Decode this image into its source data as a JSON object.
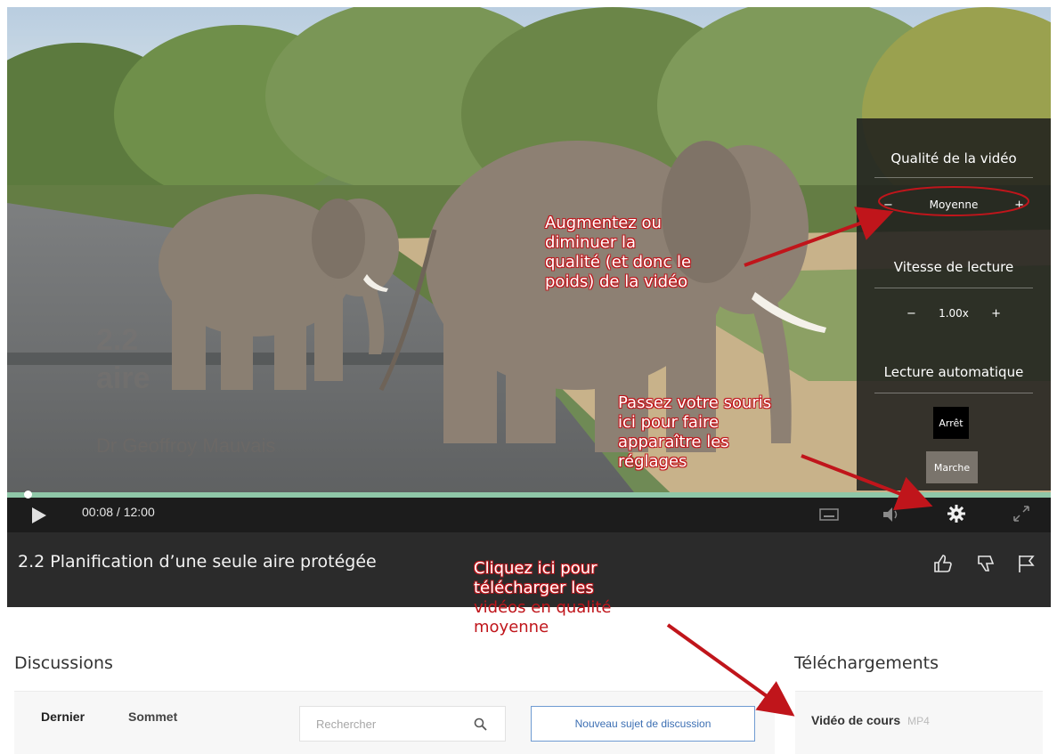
{
  "video": {
    "watermark": {
      "line1": "2.2",
      "line2": "aire",
      "presenter": "Dr Geoffroy Mauvais"
    },
    "settings": {
      "quality_title": "Qualité de la vidéo",
      "quality_minus": "−",
      "quality_value": "Moyenne",
      "quality_plus": "+",
      "speed_title": "Vitesse de lecture",
      "speed_minus": "−",
      "speed_value": "1.00x",
      "speed_plus": "+",
      "autoplay_title": "Lecture automatique",
      "autoplay_off": "Arrêt",
      "autoplay_on": "Marche"
    },
    "controls": {
      "time": "00:08 / 12:00",
      "progress_fraction": 0.011,
      "icons": [
        "play-icon",
        "captions-icon",
        "volume-icon",
        "gear-icon",
        "fullscreen-icon"
      ]
    }
  },
  "lesson": {
    "title": "2.2 Planification d’une seule aire protégée",
    "icons": [
      "thumbs-up-icon",
      "thumbs-down-icon",
      "flag-icon"
    ]
  },
  "discussions": {
    "heading": "Discussions",
    "tab_latest": "Dernier",
    "tab_top": "Sommet",
    "search_placeholder": "Rechercher",
    "new_topic_label": "Nouveau sujet de discussion"
  },
  "downloads": {
    "heading": "Téléchargements",
    "item_label": "Vidéo de cours",
    "item_format": "MP4"
  },
  "annotations": {
    "quality_note": [
      "Augmentez ou",
      "diminuer la",
      "qualité (et donc le",
      "poids) de la vidéo"
    ],
    "settings_note": [
      "Passez votre souris",
      "ici pour faire",
      "apparaître les",
      "réglages"
    ],
    "download_note": [
      "Cliquez ici pour",
      "télécharger les",
      "vidéos en qualité",
      "moyenne"
    ],
    "accent_color": "#c0151b"
  }
}
